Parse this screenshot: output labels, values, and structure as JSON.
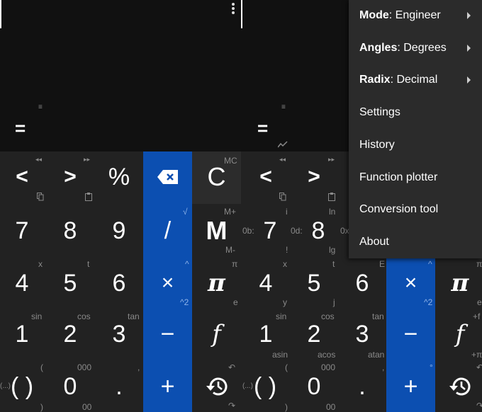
{
  "left_pane": {
    "display": {
      "equals": "=",
      "history_icon": "≡"
    },
    "keys": {
      "row1": [
        {
          "label": "<",
          "top": "◂◂",
          "bottom": "copy"
        },
        {
          "label": ">",
          "top": "▸▸",
          "bottom": "paste"
        },
        {
          "label": "%"
        },
        {
          "label": "backspace"
        },
        {
          "label": "C",
          "top": "MC"
        }
      ],
      "row2": [
        {
          "label": "7"
        },
        {
          "label": "8"
        },
        {
          "label": "9"
        },
        {
          "label": "/",
          "top": "√"
        },
        {
          "label": "M",
          "top": "M+",
          "bottom": "M-"
        }
      ],
      "row3": [
        {
          "label": "4",
          "top": "x"
        },
        {
          "label": "5",
          "top": "t"
        },
        {
          "label": "6"
        },
        {
          "label": "×",
          "top": "^",
          "bottom": "^2"
        },
        {
          "label": "π",
          "top": "π",
          "bottom": "e"
        }
      ],
      "row4": [
        {
          "label": "1",
          "top": "sin"
        },
        {
          "label": "2",
          "top": "cos"
        },
        {
          "label": "3",
          "top": "tan"
        },
        {
          "label": "−"
        },
        {
          "label": "f"
        }
      ],
      "row5": [
        {
          "label": "( )",
          "top": "(",
          "bottom": ")",
          "left": "(...)"
        },
        {
          "label": "0",
          "top": "000",
          "bottom": "00"
        },
        {
          "label": ".",
          "top": ","
        },
        {
          "label": "+"
        },
        {
          "label": "history",
          "top": "undo",
          "bottom": "redo"
        }
      ]
    }
  },
  "right_pane": {
    "display": {
      "equals": "=",
      "history_icon": "≡",
      "graph_icon": "graph"
    },
    "keys": {
      "row1": [
        {
          "label": "<",
          "top": "◂◂",
          "bottom": "copy"
        },
        {
          "label": ">",
          "top": "▸▸",
          "bottom": "paste"
        }
      ],
      "row2": [
        {
          "label": "7",
          "top": "i",
          "bottom": "!",
          "left": "0b:"
        },
        {
          "label": "8",
          "top": "ln",
          "bottom": "lg",
          "left": "0d:"
        },
        {
          "label": "",
          "left": "0x"
        }
      ],
      "row3": [
        {
          "label": "4",
          "top": "x",
          "bottom": "y"
        },
        {
          "label": "5",
          "top": "t",
          "bottom": "j"
        },
        {
          "label": "6",
          "top": "E"
        },
        {
          "label": "×",
          "top": "^",
          "bottom": "^2"
        },
        {
          "label": "π",
          "top": "π",
          "bottom": "e"
        }
      ],
      "row4": [
        {
          "label": "1",
          "top": "sin",
          "bottom": "asin"
        },
        {
          "label": "2",
          "top": "cos",
          "bottom": "acos"
        },
        {
          "label": "3",
          "top": "tan",
          "bottom": "atan"
        },
        {
          "label": "−"
        },
        {
          "label": "f",
          "top": "+f",
          "bottom": "+π"
        }
      ],
      "row5": [
        {
          "label": "( )",
          "top": "(",
          "bottom": ")",
          "left": "(...)"
        },
        {
          "label": "0",
          "top": "000",
          "bottom": "00"
        },
        {
          "label": ".",
          "top": ","
        },
        {
          "label": "+",
          "top": "°"
        },
        {
          "label": "history",
          "top": "undo",
          "bottom": "redo"
        }
      ]
    }
  },
  "menu": {
    "items": [
      {
        "key": "Mode",
        "value": ": Engineer",
        "submenu": true
      },
      {
        "key": "Angles",
        "value": ": Degrees",
        "submenu": true
      },
      {
        "key": "Radix",
        "value": ": Decimal",
        "submenu": true
      },
      {
        "key": "",
        "value": "Settings",
        "submenu": false
      },
      {
        "key": "",
        "value": "History",
        "submenu": false
      },
      {
        "key": "",
        "value": "Function plotter",
        "submenu": false
      },
      {
        "key": "",
        "value": "Conversion tool",
        "submenu": false
      },
      {
        "key": "",
        "value": "About",
        "submenu": false
      }
    ]
  },
  "colors": {
    "accent": "#0c4fb1",
    "pad_bg": "#222222",
    "display_bg": "#111111",
    "menu_bg": "#2b2b2b"
  }
}
